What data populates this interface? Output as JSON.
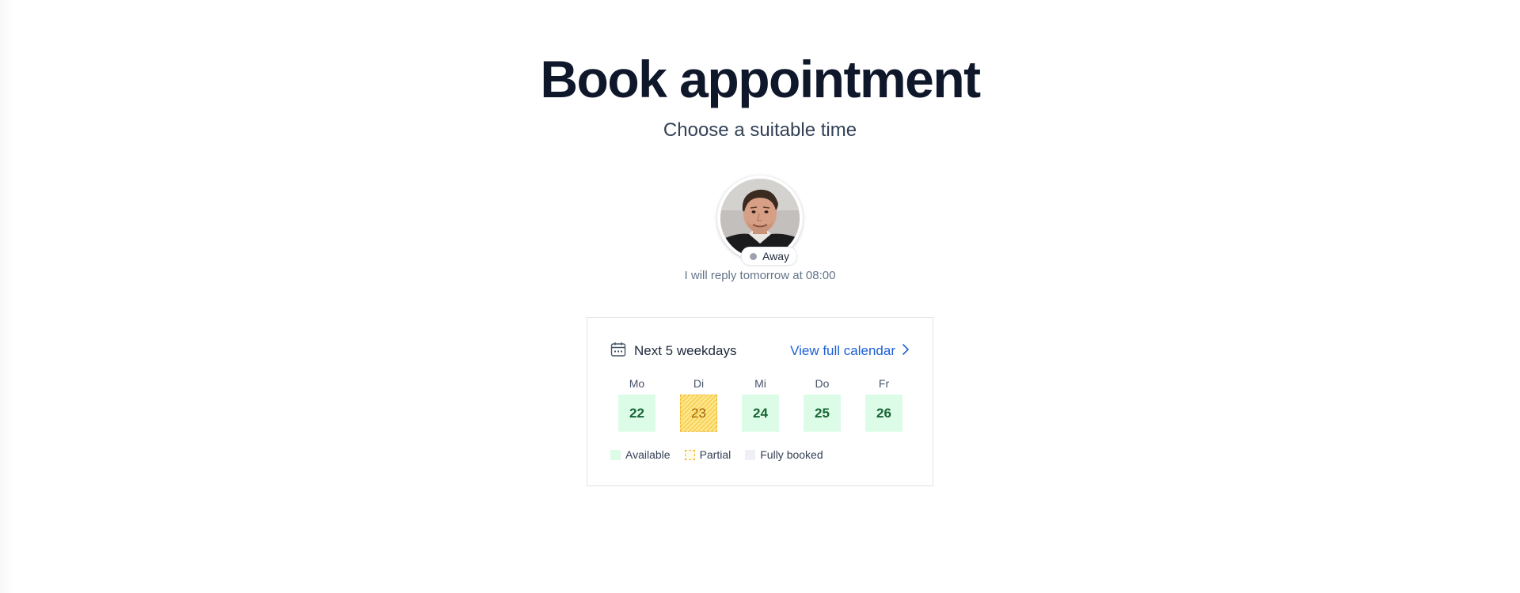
{
  "header": {
    "title": "Book appointment",
    "subtitle": "Choose a suitable time"
  },
  "profile": {
    "status": "Away",
    "status_color": "#9ca3af",
    "reply_note": "I will reply tomorrow at 08:00"
  },
  "calendar": {
    "title": "Next 5 weekdays",
    "title_icon": "calendar-icon",
    "link_label": "View full calendar",
    "link_icon": "chevron-right-icon",
    "link_color": "#1d5fd6",
    "days": [
      {
        "label": "Mo",
        "date": "22",
        "status": "available"
      },
      {
        "label": "Di",
        "date": "23",
        "status": "partial"
      },
      {
        "label": "Mi",
        "date": "24",
        "status": "available"
      },
      {
        "label": "Do",
        "date": "25",
        "status": "available"
      },
      {
        "label": "Fr",
        "date": "26",
        "status": "available"
      }
    ],
    "legend": [
      {
        "label": "Available",
        "color": "#dcfce7"
      },
      {
        "label": "Partial",
        "color": "#fde68a"
      },
      {
        "label": "Fully booked",
        "color": "#eef0f6"
      }
    ]
  }
}
